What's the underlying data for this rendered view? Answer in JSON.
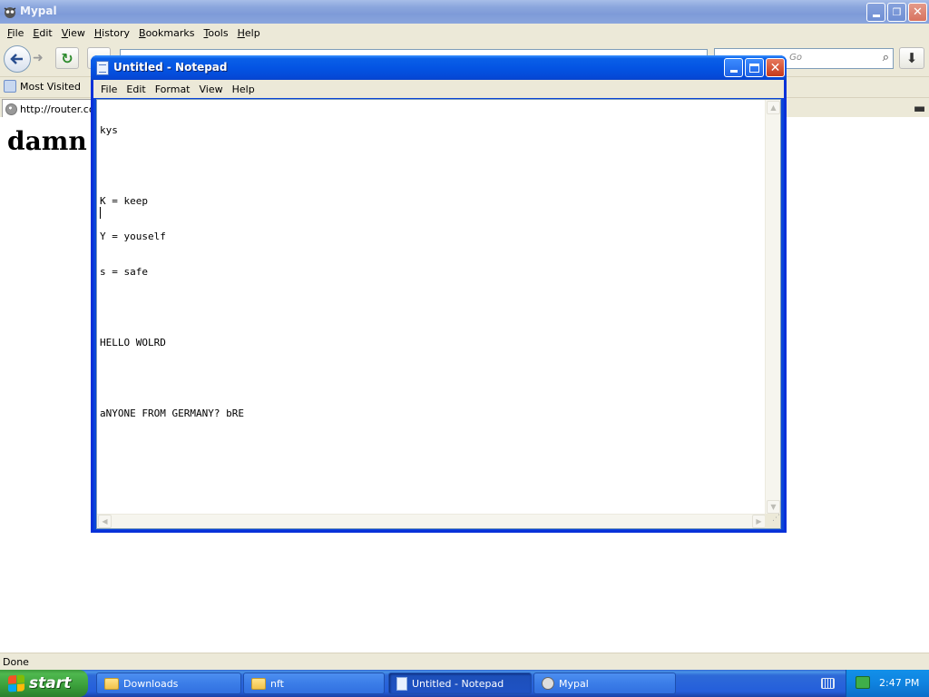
{
  "browser": {
    "title": "Mypal",
    "menu": [
      "File",
      "Edit",
      "View",
      "History",
      "Bookmarks",
      "Tools",
      "Help"
    ],
    "search_placeholder": "Go",
    "bookmarks": [
      {
        "label": "Most Visited"
      }
    ],
    "tab": {
      "label": "http://router.co"
    },
    "page_heading": "damn i",
    "status": "Done"
  },
  "notepad": {
    "title": "Untitled - Notepad",
    "menu": [
      "File",
      "Edit",
      "Format",
      "View",
      "Help"
    ],
    "lines": [
      "kys",
      "",
      "K = keep",
      "Y = youself",
      "s = safe",
      "",
      "HELLO WOLRD",
      "",
      "aNYONE FROM GERMANY? bRE",
      ""
    ]
  },
  "taskbar": {
    "start_label": "start",
    "buttons": [
      {
        "label": "Downloads",
        "icon": "folder-icon"
      },
      {
        "label": "nft",
        "icon": "folder-icon"
      },
      {
        "label": "Untitled - Notepad",
        "icon": "notepad-icon",
        "active": true
      },
      {
        "label": "Mypal",
        "icon": "mypal-icon"
      }
    ],
    "clock": "2:47 PM"
  }
}
